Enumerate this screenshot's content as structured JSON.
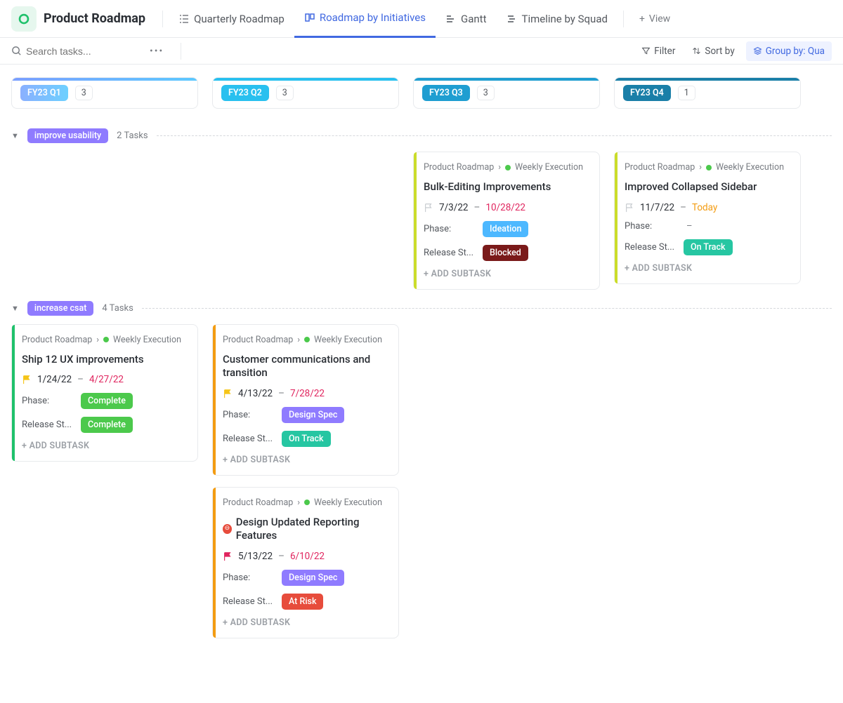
{
  "header": {
    "title": "Product Roadmap",
    "tabs": [
      {
        "label": "Quarterly Roadmap"
      },
      {
        "label": "Roadmap by Initiatives"
      },
      {
        "label": "Gantt"
      },
      {
        "label": "Timeline by Squad"
      }
    ],
    "add_view": "View"
  },
  "toolbar": {
    "search_placeholder": "Search tasks...",
    "filter": "Filter",
    "sort": "Sort by",
    "group": "Group by: Qua"
  },
  "columns": [
    {
      "label": "FY23 Q1",
      "count": "3"
    },
    {
      "label": "FY23 Q2",
      "count": "3"
    },
    {
      "label": "FY23 Q3",
      "count": "3"
    },
    {
      "label": "FY23 Q4",
      "count": "1"
    }
  ],
  "groups": [
    {
      "label": "improve usability",
      "count": "2 Tasks",
      "cards": [
        null,
        null,
        {
          "crumb_root": "Product Roadmap",
          "crumb_leaf": "Weekly Execution",
          "title": "Bulk-Editing Improvements",
          "flag": "gray",
          "start": "7/3/22",
          "end": "10/28/22",
          "end_style": "date-end",
          "phase": {
            "text": "Ideation",
            "cls": "ideation"
          },
          "release": {
            "text": "Blocked",
            "cls": "blocked"
          },
          "stripe": "olive"
        },
        {
          "crumb_root": "Product Roadmap",
          "crumb_leaf": "Weekly Execution",
          "title": "Improved Collapsed Sidebar",
          "flag": "gray",
          "start": "11/7/22",
          "end": "Today",
          "end_style": "date-today",
          "phase": null,
          "release": {
            "text": "On Track",
            "cls": "ontrack"
          },
          "stripe": "olive"
        }
      ]
    },
    {
      "label": "increase csat",
      "count": "4 Tasks",
      "cards": [
        {
          "crumb_root": "Product Roadmap",
          "crumb_leaf": "Weekly Execution",
          "title": "Ship 12 UX improvements",
          "flag": "yellow",
          "start": "1/24/22",
          "end": "4/27/22",
          "end_style": "date-end",
          "phase": {
            "text": "Complete",
            "cls": "complete"
          },
          "release": {
            "text": "Complete",
            "cls": "complete"
          },
          "stripe": "green"
        },
        [
          {
            "crumb_root": "Product Roadmap",
            "crumb_leaf": "Weekly Execution",
            "title": "Customer communications and transition",
            "flag": "yellow",
            "start": "4/13/22",
            "end": "7/28/22",
            "end_style": "date-end",
            "phase": {
              "text": "Design Spec",
              "cls": "designspec"
            },
            "release": {
              "text": "On Track",
              "cls": "ontrack"
            },
            "stripe": "orange"
          },
          {
            "crumb_root": "Product Roadmap",
            "crumb_leaf": "Weekly Execution",
            "title": "Design Updated Reporting Features",
            "blocked_icon": true,
            "flag": "red",
            "start": "5/13/22",
            "end": "6/10/22",
            "end_style": "date-end",
            "phase": {
              "text": "Design Spec",
              "cls": "designspec"
            },
            "release": {
              "text": "At Risk",
              "cls": "atrisk"
            },
            "stripe": "orange"
          }
        ],
        null,
        null
      ]
    }
  ],
  "labels": {
    "phase": "Phase:",
    "release": "Release St...",
    "add_subtask": "+ ADD SUBTASK",
    "crumb_sep": "›"
  }
}
